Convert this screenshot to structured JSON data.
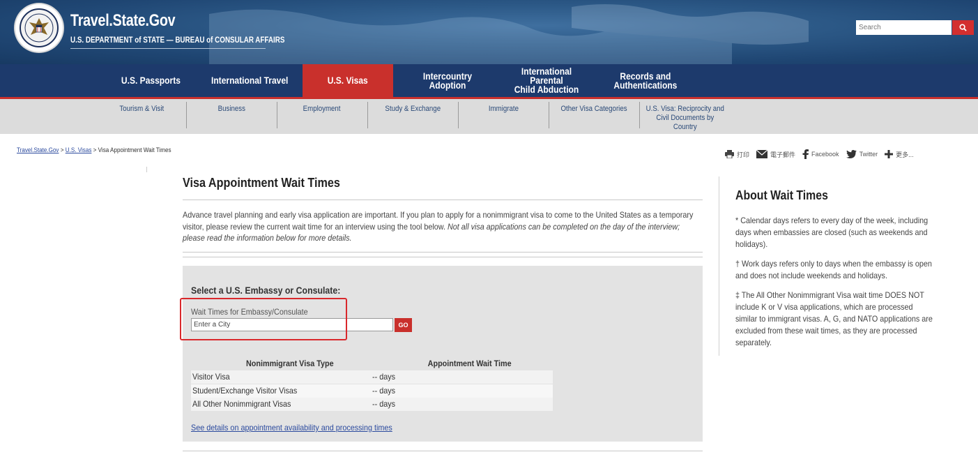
{
  "header": {
    "site_title": "Travel.State.Gov",
    "site_subtitle": "U.S. DEPARTMENT of STATE — BUREAU of CONSULAR AFFAIRS",
    "search_placeholder": "Search",
    "accent_color": "#c9302c",
    "nav_color": "#1d3a6c"
  },
  "main_nav": [
    {
      "label": "U.S. Passports"
    },
    {
      "label": "International Travel"
    },
    {
      "label": "U.S. Visas",
      "active": true
    },
    {
      "label": "Intercountry Adoption"
    },
    {
      "label": "International Parental\nChild Abduction"
    },
    {
      "label": "Records and\nAuthentications"
    }
  ],
  "sub_nav": [
    {
      "label": "Tourism & Visit"
    },
    {
      "label": "Business"
    },
    {
      "label": "Employment"
    },
    {
      "label": "Study & Exchange"
    },
    {
      "label": "Immigrate"
    },
    {
      "label": "Other Visa Categories"
    },
    {
      "label": "U.S. Visa: Reciprocity and\nCivil Documents by\nCountry"
    }
  ],
  "breadcrumb": {
    "home": "Travel.State.Gov",
    "sep1": " > ",
    "visas": "U.S. Visas",
    "sep2": " > ",
    "current": "Visa Appointment Wait Times"
  },
  "share": {
    "print": "打印",
    "email": "電子郵件",
    "facebook": "Facebook",
    "twitter": "Twitter",
    "more": "更多..."
  },
  "main": {
    "title": "Visa Appointment Wait Times",
    "intro_plain": "Advance travel planning and early visa application are important. If you plan to apply for a nonimmigrant visa to come to the United States as a temporary visitor, please review the current wait time for an interview using the tool below. ",
    "intro_italic": "Not all visa applications can be completed on the day of the interview; please read the information below for more details.",
    "select_heading": "Select a U.S. Embassy or Consulate:",
    "wait_label": "Wait Times for Embassy/Consulate",
    "city_placeholder": "Enter a City",
    "go_label": "GO",
    "table": {
      "col1": "Nonimmigrant Visa Type",
      "col2": "Appointment Wait Time",
      "rows": [
        {
          "type": "Visitor Visa",
          "wait": "-- days"
        },
        {
          "type": "Student/Exchange Visitor Visas",
          "wait": "-- days"
        },
        {
          "type": "All Other Nonimmigrant Visas",
          "wait": "-- days"
        }
      ]
    },
    "details_link": "See details on appointment availability and processing times"
  },
  "sidebar": {
    "title": "About Wait Times",
    "p1": "* Calendar days refers to every day of the week, including days when embassies are closed (such as weekends and holidays).",
    "p2": "† Work days refers only to days when the embassy is open and does not include weekends and holidays.",
    "p3": "‡ The All Other Nonimmigrant Visa wait time DOES NOT include K or V visa applications, which are processed similar to immigrant visas.  A, G, and NATO applications are excluded from these wait times, as they are processed separately."
  }
}
